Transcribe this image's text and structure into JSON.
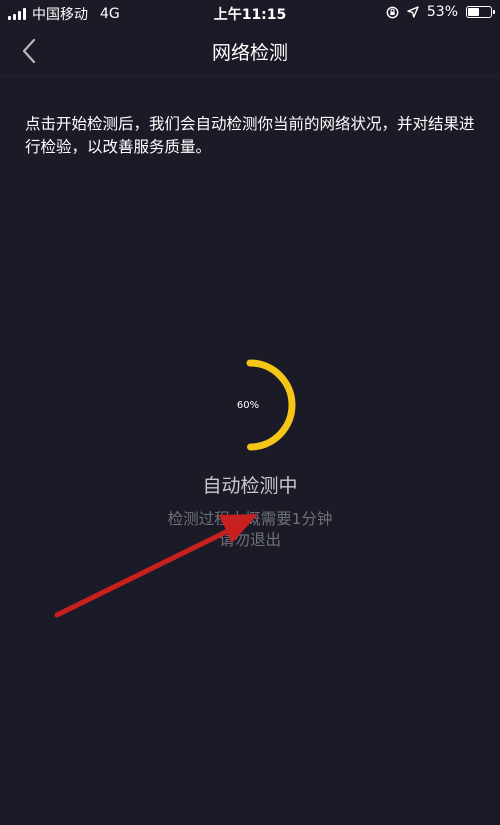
{
  "status_bar": {
    "carrier": "中国移动",
    "network": "4G",
    "time": "上午11:15",
    "battery_percent": "53%",
    "battery_level": 0.53
  },
  "nav": {
    "title": "网络检测",
    "back_icon": "chevron-left-icon"
  },
  "description": "点击开始检测后，我们会自动检测你当前的网络状况，并对结果进行检验，以改善服务质量。",
  "progress": {
    "percent_label": "60%",
    "value": 0.6,
    "color": "#f5c518"
  },
  "status_title": "自动检测中",
  "hint": {
    "line1": "检测过程大概需要1分钟",
    "line2": "请勿退出"
  },
  "colors": {
    "background": "#1a1b26",
    "accent": "#f5c518",
    "annotation_arrow": "#c8201f"
  }
}
